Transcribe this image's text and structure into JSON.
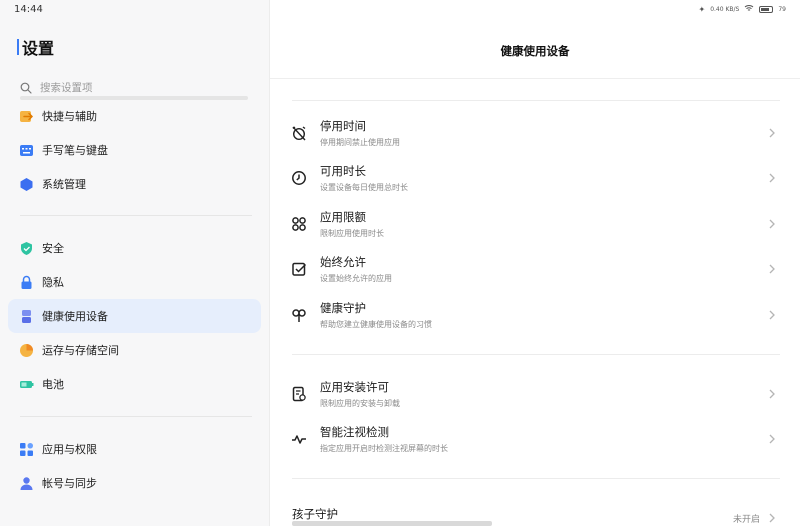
{
  "status_bar": {
    "time": "14:44",
    "net_speed": "0.40 KB/S",
    "battery": "79"
  },
  "sidebar": {
    "title": "设置",
    "search_placeholder": "搜索设置项",
    "items": [
      {
        "label": "快捷与辅助",
        "icon": "arrow-right-icon"
      },
      {
        "label": "手写笔与键盘",
        "icon": "keyboard-icon"
      },
      {
        "label": "系统管理",
        "icon": "hexagon-icon"
      },
      {
        "label": "安全",
        "icon": "shield-icon"
      },
      {
        "label": "隐私",
        "icon": "lock-icon"
      },
      {
        "label": "健康使用设备",
        "icon": "hourglass-icon"
      },
      {
        "label": "运存与存储空间",
        "icon": "pie-icon"
      },
      {
        "label": "电池",
        "icon": "battery-icon"
      },
      {
        "label": "应用与权限",
        "icon": "apps-icon"
      },
      {
        "label": "帐号与同步",
        "icon": "user-icon"
      }
    ]
  },
  "main": {
    "title": "健康使用设备",
    "rows": [
      {
        "title": "停用时间",
        "subtitle": "停用期间禁止使用应用",
        "icon": "alarm-off-icon"
      },
      {
        "title": "可用时长",
        "subtitle": "设置设备每日使用总时长",
        "icon": "clock-icon"
      },
      {
        "title": "应用限额",
        "subtitle": "限制应用使用时长",
        "icon": "app-limit-icon"
      },
      {
        "title": "始终允许",
        "subtitle": "设置始终允许的应用",
        "icon": "checkbox-icon"
      },
      {
        "title": "健康守护",
        "subtitle": "帮助您建立健康使用设备的习惯",
        "icon": "sprout-icon"
      },
      {
        "title": "应用安装许可",
        "subtitle": "限制应用的安装与卸载",
        "icon": "install-permit-icon"
      },
      {
        "title": "智能注视检测",
        "subtitle": "指定应用开启时检测注视屏幕的时长",
        "icon": "pulse-icon"
      }
    ],
    "kids": {
      "title": "孩子守护",
      "status": "未开启"
    }
  },
  "colors": {
    "accent": "#3b7cf5",
    "active_bg": "#e6eefc"
  }
}
